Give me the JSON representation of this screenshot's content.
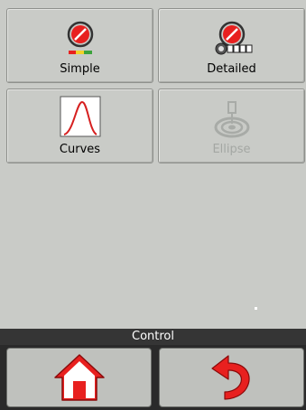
{
  "tiles": [
    {
      "label": "Simple",
      "icon": "gauge-icon",
      "enabled": true
    },
    {
      "label": "Detailed",
      "icon": "gauge-detailed-icon",
      "enabled": true
    },
    {
      "label": "Curves",
      "icon": "curve-chart-icon",
      "enabled": true
    },
    {
      "label": "Ellipse",
      "icon": "ellipse-target-icon",
      "enabled": false
    }
  ],
  "title_bar": {
    "title": "Control"
  },
  "nav": {
    "home_icon": "home-icon",
    "back_icon": "back-arrow-icon"
  },
  "colors": {
    "background": "#c9cbc7",
    "title_bar": "#353535",
    "accent_red": "#e8201f",
    "disabled_text": "#a4a7a3"
  }
}
